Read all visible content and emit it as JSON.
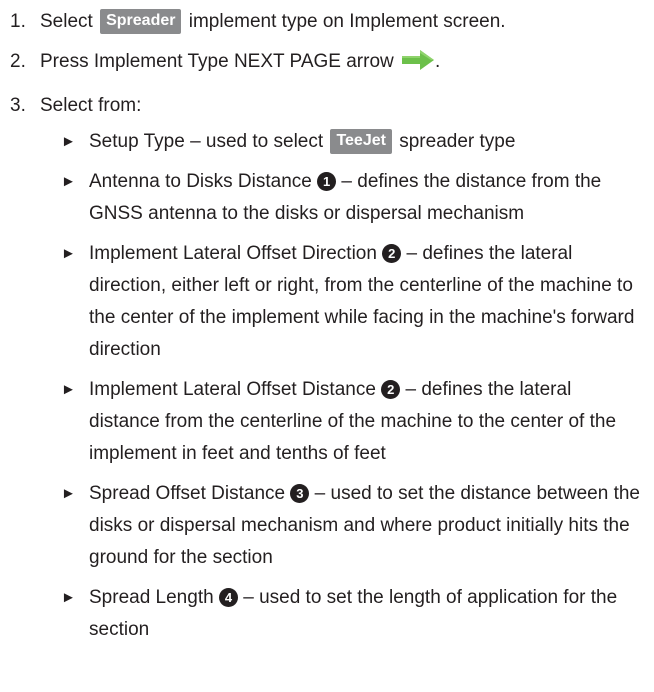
{
  "steps": [
    {
      "num": "1.",
      "pre": "Select",
      "badge": "Spreader",
      "post": "implement type on Implement screen."
    },
    {
      "num": "2.",
      "pre": "Press Implement Type NEXT PAGE arrow",
      "post": "."
    },
    {
      "num": "3.",
      "text": "Select from:"
    }
  ],
  "bullets": [
    {
      "marker": "►",
      "label": "Setup Type",
      "pre": "– used to select",
      "badge": "TeeJet",
      "post": "spreader type"
    },
    {
      "marker": "►",
      "label": "Antenna to Disks Distance",
      "num": "1",
      "desc": "– defines the distance from the GNSS antenna to the disks or dispersal mechanism"
    },
    {
      "marker": "►",
      "label": "Implement Lateral Offset Direction",
      "num": "2",
      "desc": "– defines the lateral direction, either left or right, from the centerline of the machine to the center of the implement while facing in the machine's forward direction"
    },
    {
      "marker": "►",
      "label": "Implement Lateral Offset Distance",
      "num": "2",
      "desc": "– defines the lateral distance from the centerline of the machine to the center of the implement in feet and tenths of feet"
    },
    {
      "marker": "►",
      "label": "Spread Offset Distance",
      "num": "3",
      "desc": "– used to set the distance between the disks or dispersal mechanism and where product initially hits the ground for the section"
    },
    {
      "marker": "►",
      "label": "Spread Length",
      "num": "4",
      "desc": "– used to set the length of application for the section"
    }
  ],
  "icons": {
    "next_page_arrow": "right-arrow-icon"
  },
  "colors": {
    "badge_bg": "#8a8b8d",
    "arrow_green": "#6cc04a",
    "text": "#231f20"
  }
}
